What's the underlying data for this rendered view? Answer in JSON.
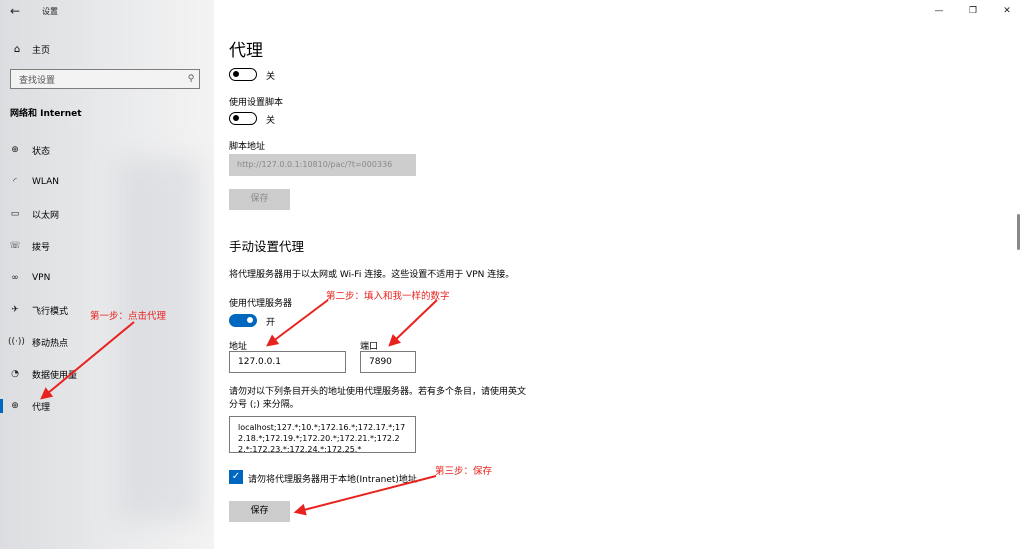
{
  "window": {
    "back_icon": "arrow-left-icon",
    "title": "设置",
    "controls": {
      "minimize": "—",
      "restore": "❐",
      "close": "✕"
    }
  },
  "sidebar": {
    "home": {
      "icon": "home-icon",
      "label": "主页"
    },
    "search": {
      "placeholder": "查找设置",
      "icon": "search-icon"
    },
    "section_title": "网络和 Internet",
    "items": [
      {
        "icon": "globe-status-icon",
        "label": "状态"
      },
      {
        "icon": "wifi-icon",
        "label": "WLAN"
      },
      {
        "icon": "ethernet-icon",
        "label": "以太网"
      },
      {
        "icon": "phone-icon",
        "label": "拨号"
      },
      {
        "icon": "vpn-icon",
        "label": "VPN"
      },
      {
        "icon": "airplane-icon",
        "label": "飞行模式"
      },
      {
        "icon": "hotspot-icon",
        "label": "移动热点"
      },
      {
        "icon": "data-usage-icon",
        "label": "数据使用量"
      },
      {
        "icon": "globe-icon",
        "label": "代理"
      }
    ],
    "active_index": 8
  },
  "main": {
    "page_title": "代理",
    "auto_detect": {
      "state": "关",
      "on": false
    },
    "use_script_label": "使用设置脚本",
    "use_script": {
      "state": "关",
      "on": false
    },
    "script_address_label": "脚本地址",
    "script_address_value": "http://127.0.0.1:10810/pac/?t=000336",
    "save_script_button": "保存",
    "manual_header": "手动设置代理",
    "manual_description": "将代理服务器用于以太网或 Wi-Fi 连接。这些设置不适用于 VPN 连接。",
    "use_proxy_label": "使用代理服务器",
    "use_proxy": {
      "state": "开",
      "on": true
    },
    "address_label": "地址",
    "address_value": "127.0.0.1",
    "port_label": "端口",
    "port_value": "7890",
    "exceptions_label": "请勿对以下列条目开头的地址使用代理服务器。若有多个条目，请使用英文分号 (;) 来分隔。",
    "exceptions_value": "localhost;127.*;10.*;172.16.*;172.17.*;172.18.*;172.19.*;172.20.*;172.21.*;172.22.*;172.23.*;172.24.*;172.25.*",
    "bypass_local_checked": true,
    "bypass_local_label": "请勿将代理服务器用于本地(Intranet)地址",
    "save_button": "保存"
  },
  "annotations": {
    "step1": "第一步：点击代理",
    "step2": "第二步：填入和我一样的数字",
    "step3": "第三步：保存",
    "color": "#e8231e"
  },
  "accent_color": "#0067c0"
}
